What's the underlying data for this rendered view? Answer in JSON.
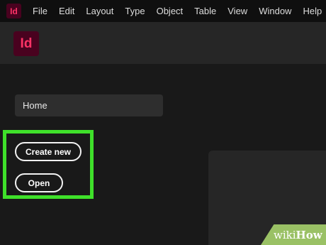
{
  "app": {
    "logo_text": "Id",
    "accent_color": "#ff3366",
    "logo_bg": "#49021f"
  },
  "menubar": {
    "items": [
      "File",
      "Edit",
      "Layout",
      "Type",
      "Object",
      "Table",
      "View",
      "Window",
      "Help"
    ]
  },
  "sidebar": {
    "home_label": "Home"
  },
  "actions": {
    "create_new_label": "Create new",
    "open_label": "Open",
    "highlight_color": "#3fe02a"
  },
  "watermark": {
    "wiki": "wiki",
    "how": "How"
  }
}
